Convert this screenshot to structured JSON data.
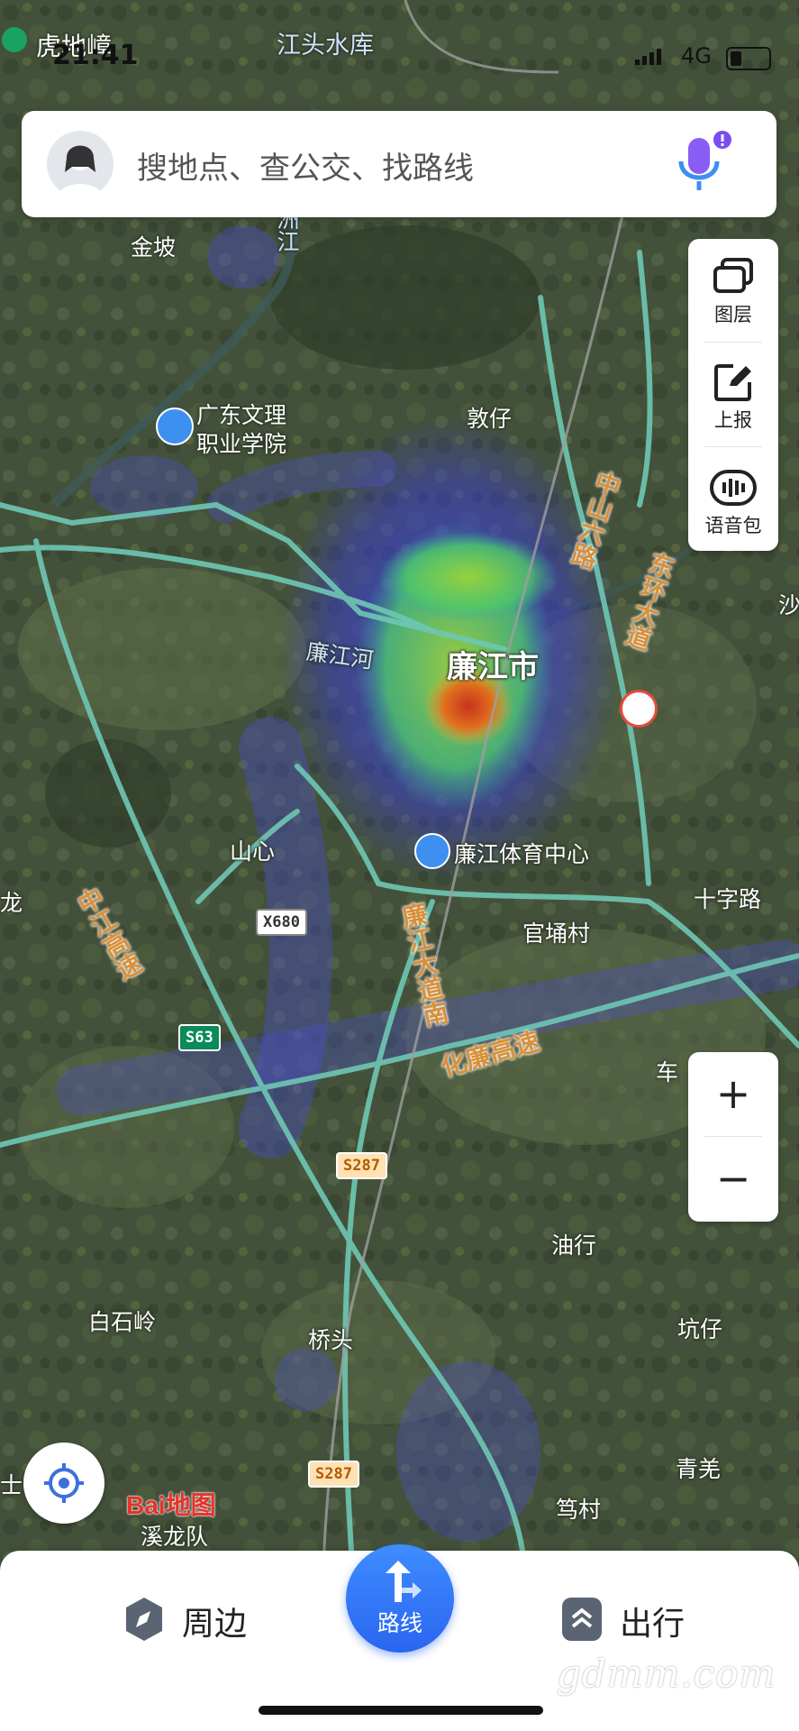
{
  "status_bar": {
    "time": "21:41",
    "network": "4G"
  },
  "search": {
    "placeholder": "搜地点、查公交、找路线"
  },
  "side_panel": {
    "items": [
      {
        "label": "图层",
        "icon": "layers-icon"
      },
      {
        "label": "上报",
        "icon": "report-edit-icon"
      },
      {
        "label": "语音包",
        "icon": "voice-pack-icon"
      }
    ]
  },
  "zoom": {
    "in_label": "+",
    "out_label": "−"
  },
  "map": {
    "places": {
      "hudizhang": "虎地嶂",
      "jiangtou": "江头水库",
      "jinpo": "金坡",
      "jiuzhoujiang": "九洲江",
      "college": "广东文理\n职业学院",
      "dunzi": "敦仔",
      "city": "廉江市",
      "lianjianghe": "廉江河",
      "stadium": "廉江体育中心",
      "shanxin": "山心",
      "guanyongcun": "官埇村",
      "shizilu": "十字路",
      "youhang": "油行",
      "baishiling": "白石岭",
      "qiaotou": "桥头",
      "kengzai": "坑仔",
      "qingqiang": "青羌",
      "dongcun": "笃村",
      "lianglong": "溪龙队",
      "longtown": "龙",
      "che": "车",
      "sha": "沙",
      "shi": "士"
    },
    "roads": {
      "zhongshan": "中山六路",
      "dongjing": "东环大道",
      "lianjiang_dadao": "廉江大道南",
      "hualian": "化廉高速",
      "expressway": "中江高速"
    },
    "shields": [
      "X680",
      "S63",
      "S287",
      "S287"
    ]
  },
  "map_logo": {
    "text": "Bai地图"
  },
  "bottom_nav": {
    "nearby_label": "周边",
    "route_label": "路线",
    "travel_label": "出行"
  },
  "watermark": "gdmm.com",
  "colors": {
    "accent": "#2a66f0",
    "road": "#6fc7b5",
    "mic": "#8a5cf6"
  }
}
